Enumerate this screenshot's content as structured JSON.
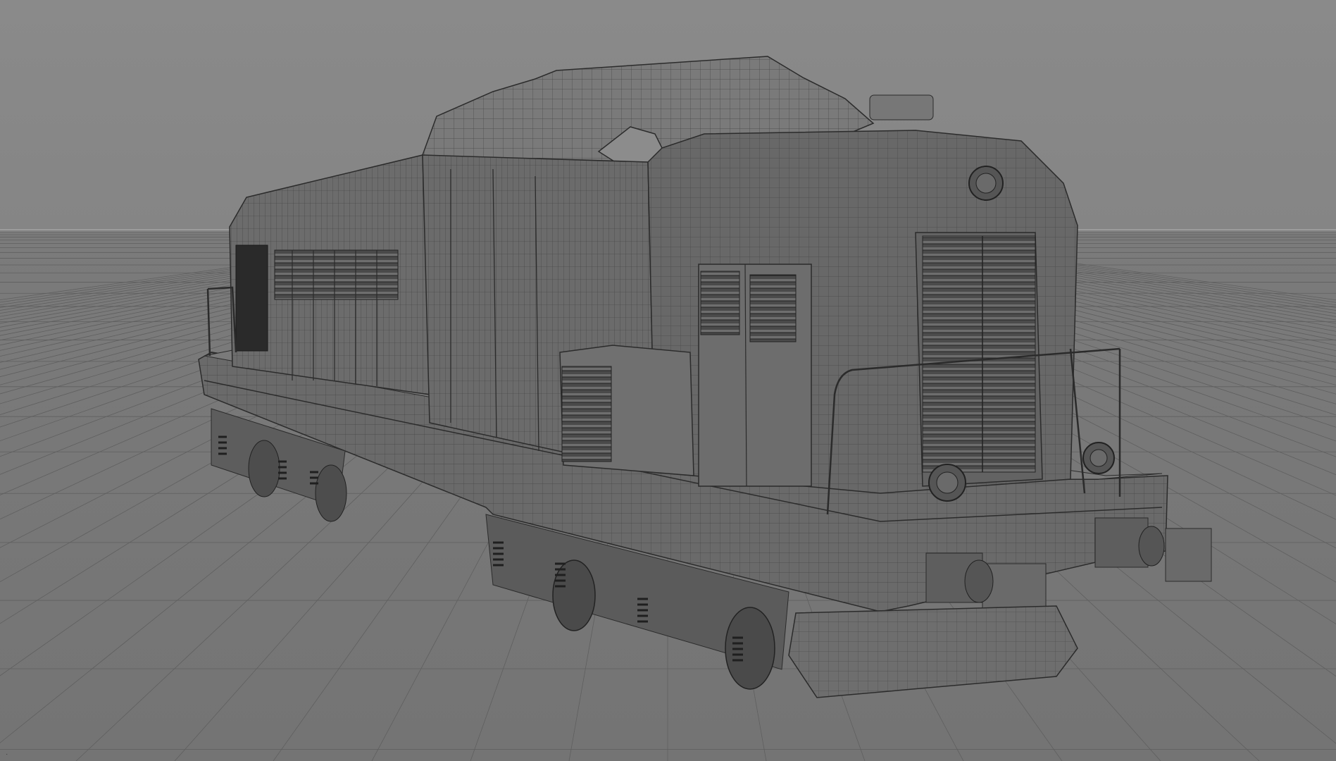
{
  "viewport": {
    "panel": "perspective",
    "display_mode": "wireframe-on-shaded",
    "corner_mark": "·"
  },
  "colors": {
    "background_top": "#8a8a8a",
    "background_floor": "#747474",
    "grid_line": "#5f5f5f",
    "horizon_line": "#b4b4b4",
    "model_body": "#6c6c6c",
    "model_dark": "#3c3c3c",
    "model_light": "#7a7a7a",
    "wire": "#2d2d2d"
  },
  "model": {
    "type": "diesel locomotive",
    "icons": [
      "locomotive-mesh-icon",
      "louver-icon",
      "headlight-icon",
      "buffer-icon",
      "handrail-icon",
      "bogie-icon",
      "spring-icon"
    ]
  }
}
